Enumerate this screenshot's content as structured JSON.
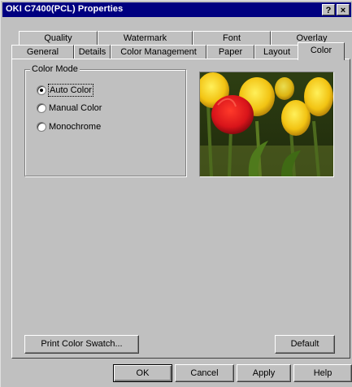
{
  "window": {
    "title": "OKI C7400(PCL) Properties"
  },
  "titlebar_buttons": {
    "help": "?",
    "close": "×"
  },
  "tabs": {
    "row1": [
      "Quality",
      "Watermark",
      "Font",
      "Overlay"
    ],
    "row2": [
      "General",
      "Details",
      "Color Management",
      "Paper",
      "Layout",
      "Color"
    ],
    "active": "Color"
  },
  "color_mode": {
    "group_label": "Color Mode",
    "options": [
      "Auto Color",
      "Manual Color",
      "Monochrome"
    ],
    "selected": "Auto Color"
  },
  "preview": {
    "image": "tulips-photo"
  },
  "buttons": {
    "print_swatch": "Print Color Swatch...",
    "default": "Default",
    "ok": "OK",
    "cancel": "Cancel",
    "apply": "Apply",
    "help": "Help"
  },
  "colors": {
    "titlebar": "#000080",
    "face": "#c0c0c0"
  }
}
